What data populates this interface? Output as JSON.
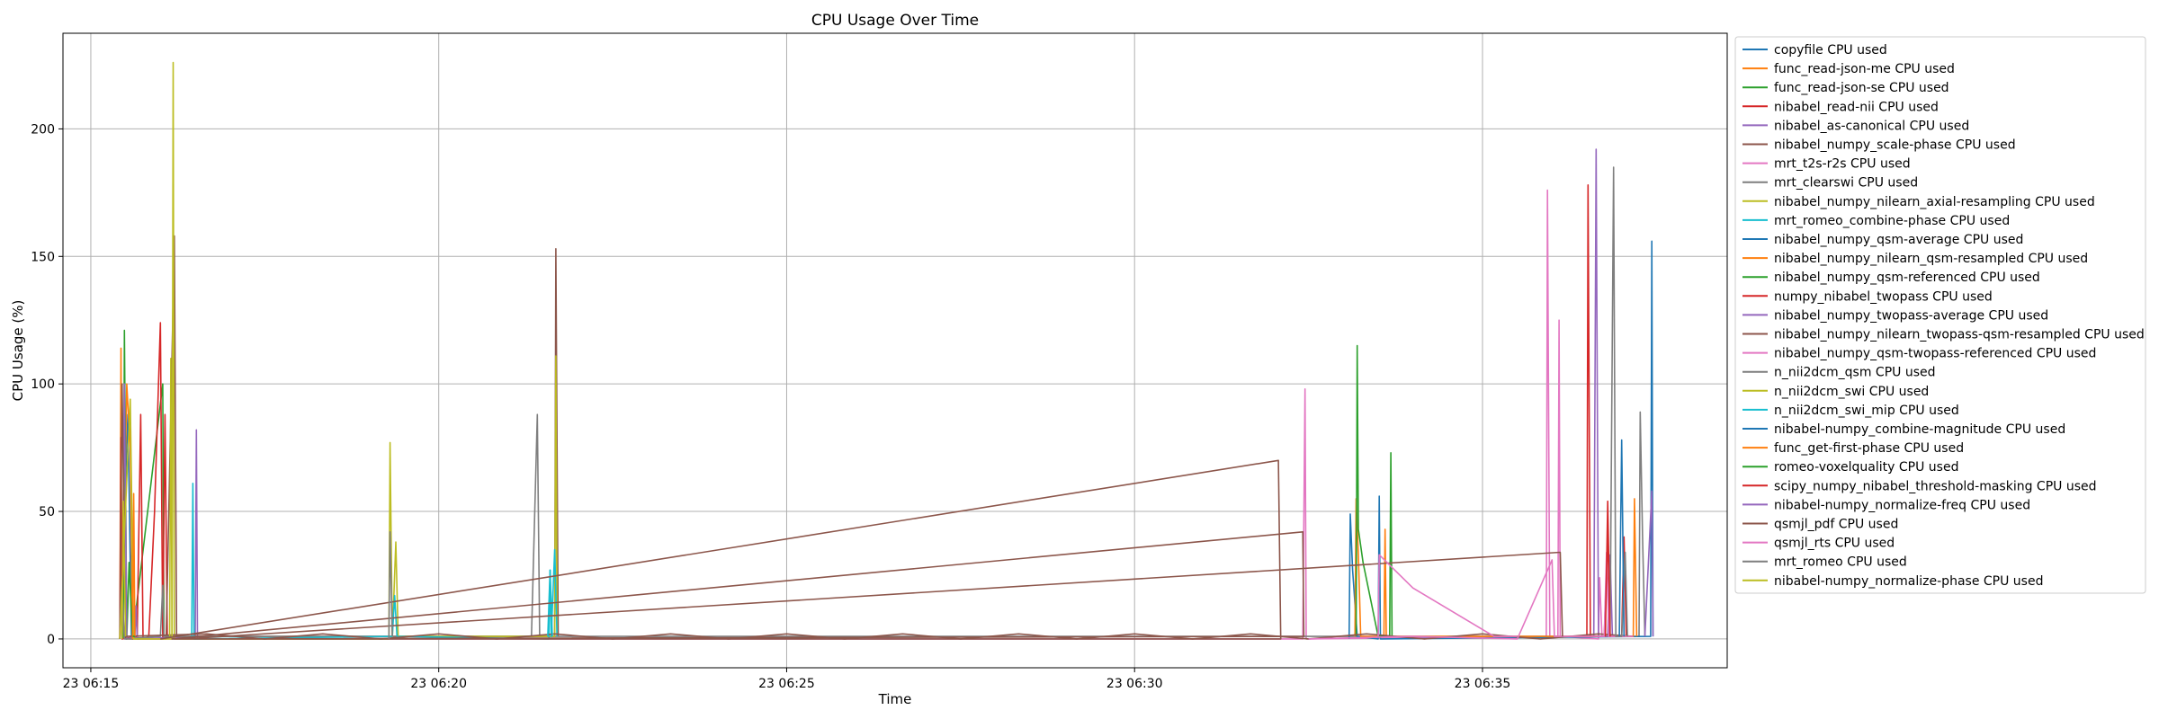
{
  "chart_data": {
    "type": "line",
    "title": "CPU Usage Over Time",
    "xlabel": "Time",
    "ylabel": "CPU Usage (%)",
    "x_unit": "time of day (HH:MM:SS), day 23",
    "x_ticks": [
      "06:15",
      "06:20",
      "06:25",
      "06:30",
      "06:35"
    ],
    "x_tick_labels": [
      "23 06:15",
      "23 06:20",
      "23 06:25",
      "23 06:30",
      "23 06:35"
    ],
    "xlim": [
      "06:14:36",
      "06:38:31"
    ],
    "y_ticks": [
      0,
      50,
      100,
      150,
      200
    ],
    "ylim": [
      -11.3,
      237.5
    ],
    "grid": true,
    "legend_position": "outside right",
    "series": [
      {
        "name": "copyfile CPU used",
        "color": "#1f77b4",
        "points": [
          [
            "06:15:25",
            0
          ],
          [
            "06:15:32",
            88
          ],
          [
            "06:15:35",
            1
          ],
          [
            "06:15:40",
            1
          ]
        ]
      },
      {
        "name": "func_read-json-me CPU used",
        "color": "#ff7f0e",
        "points": [
          [
            "06:15:25",
            0
          ],
          [
            "06:15:26",
            114
          ],
          [
            "06:15:27",
            0
          ],
          [
            "06:15:29",
            45
          ],
          [
            "06:15:31",
            100
          ],
          [
            "06:15:34",
            75
          ],
          [
            "06:15:36",
            1
          ]
        ]
      },
      {
        "name": "func_read-json-se CPU used",
        "color": "#2ca02c",
        "points": [
          [
            "06:15:28",
            0
          ],
          [
            "06:15:29",
            121
          ],
          [
            "06:15:31",
            0
          ],
          [
            "06:15:33",
            30
          ],
          [
            "06:15:36",
            0
          ],
          [
            "06:16:02",
            100
          ],
          [
            "06:16:03",
            1
          ]
        ]
      },
      {
        "name": "nibabel_read-nii CPU used",
        "color": "#d62728",
        "points": [
          [
            "06:15:25",
            0
          ],
          [
            "06:15:26",
            79
          ],
          [
            "06:15:27",
            0
          ],
          [
            "06:15:40",
            1
          ],
          [
            "06:15:43",
            88
          ],
          [
            "06:15:45",
            0
          ],
          [
            "06:15:50",
            1
          ],
          [
            "06:15:55",
            50
          ],
          [
            "06:16:00",
            124
          ],
          [
            "06:16:02",
            0
          ],
          [
            "06:16:04",
            88
          ],
          [
            "06:16:06",
            0
          ]
        ]
      },
      {
        "name": "nibabel_as-canonical CPU used",
        "color": "#9467bd",
        "points": [
          [
            "06:15:27",
            0
          ],
          [
            "06:15:29",
            100
          ],
          [
            "06:15:31",
            0
          ],
          [
            "06:15:38",
            1
          ],
          [
            "06:15:39",
            13
          ],
          [
            "06:15:40",
            0
          ],
          [
            "06:16:30",
            1
          ],
          [
            "06:16:31",
            82
          ],
          [
            "06:16:32",
            0
          ]
        ]
      },
      {
        "name": "nibabel_numpy_scale-phase CPU used",
        "color": "#8c564b",
        "points": [
          [
            "06:15:25",
            0
          ],
          [
            "06:15:27",
            100
          ],
          [
            "06:15:30",
            0
          ],
          [
            "06:16:05",
            0
          ],
          [
            "06:16:10",
            110
          ],
          [
            "06:16:12",
            158
          ],
          [
            "06:16:14",
            1
          ],
          [
            "06:21:40",
            1
          ],
          [
            "06:21:41",
            153
          ],
          [
            "06:21:43",
            1
          ]
        ]
      },
      {
        "name": "mrt_t2s-r2s CPU used",
        "color": "#e377c2",
        "points": [
          [
            "06:15:40",
            1
          ],
          [
            "06:15:42",
            0
          ],
          [
            "06:32:25",
            0
          ],
          [
            "06:32:27",
            98
          ],
          [
            "06:32:28",
            0
          ],
          [
            "06:35:55",
            1
          ],
          [
            "06:35:56",
            176
          ],
          [
            "06:35:58",
            1
          ],
          [
            "06:36:05",
            1
          ],
          [
            "06:36:06",
            125
          ],
          [
            "06:36:07",
            1
          ],
          [
            "06:36:40",
            0
          ],
          [
            "06:36:41",
            24
          ],
          [
            "06:36:43",
            1
          ]
        ]
      },
      {
        "name": "mrt_clearswi CPU used",
        "color": "#7f7f7f",
        "points": [
          [
            "06:15:25",
            0
          ],
          [
            "06:15:27",
            20
          ],
          [
            "06:15:29",
            0
          ],
          [
            "06:16:00",
            1
          ],
          [
            "06:16:02",
            21
          ],
          [
            "06:16:03",
            1
          ],
          [
            "06:21:20",
            1
          ],
          [
            "06:21:25",
            88
          ],
          [
            "06:21:27",
            1
          ],
          [
            "06:37:15",
            1
          ],
          [
            "06:37:16",
            89
          ],
          [
            "06:37:18",
            40
          ],
          [
            "06:37:20",
            1
          ]
        ]
      },
      {
        "name": "nibabel_numpy_nilearn_axial-resampling CPU used",
        "color": "#bcbd22",
        "points": [
          [
            "06:15:25",
            0
          ],
          [
            "06:15:34",
            94
          ],
          [
            "06:15:37",
            0
          ],
          [
            "06:16:10",
            0
          ],
          [
            "06:16:11",
            226
          ],
          [
            "06:16:12",
            0
          ],
          [
            "06:19:17",
            0
          ],
          [
            "06:19:18",
            77
          ],
          [
            "06:19:20",
            0
          ],
          [
            "06:19:23",
            38
          ],
          [
            "06:19:25",
            1
          ],
          [
            "06:21:40",
            1
          ],
          [
            "06:21:41",
            111
          ],
          [
            "06:21:42",
            1
          ]
        ]
      },
      {
        "name": "mrt_romeo_combine-phase CPU used",
        "color": "#17becf",
        "points": [
          [
            "06:16:27",
            0
          ],
          [
            "06:16:28",
            61
          ],
          [
            "06:16:29",
            0
          ],
          [
            "06:19:20",
            1
          ],
          [
            "06:19:22",
            17
          ],
          [
            "06:19:24",
            1
          ],
          [
            "06:21:35",
            0
          ],
          [
            "06:21:36",
            27
          ],
          [
            "06:21:37",
            1
          ],
          [
            "06:21:40",
            35
          ],
          [
            "06:21:42",
            1
          ]
        ]
      },
      {
        "name": "nibabel_numpy_qsm-average CPU used",
        "color": "#1f77b4",
        "points": [
          [
            "06:33:05",
            0
          ],
          [
            "06:33:06",
            49
          ],
          [
            "06:33:08",
            27
          ],
          [
            "06:33:12",
            1
          ],
          [
            "06:33:30",
            0
          ],
          [
            "06:33:31",
            56
          ],
          [
            "06:33:32",
            0
          ],
          [
            "06:37:25",
            1
          ],
          [
            "06:37:26",
            156
          ],
          [
            "06:37:27",
            1
          ]
        ]
      },
      {
        "name": "nibabel_numpy_nilearn_qsm-resampled CPU used",
        "color": "#ff7f0e",
        "points": [
          [
            "06:33:10",
            1
          ],
          [
            "06:33:11",
            55
          ],
          [
            "06:33:13",
            33
          ],
          [
            "06:33:15",
            1
          ],
          [
            "06:33:35",
            1
          ],
          [
            "06:33:36",
            43
          ],
          [
            "06:33:37",
            1
          ],
          [
            "06:37:10",
            1
          ],
          [
            "06:37:11",
            55
          ],
          [
            "06:37:13",
            1
          ]
        ]
      },
      {
        "name": "nibabel_numpy_qsm-referenced CPU used",
        "color": "#2ca02c",
        "points": [
          [
            "06:33:11",
            1
          ],
          [
            "06:33:12",
            115
          ],
          [
            "06:33:13",
            43
          ],
          [
            "06:33:17",
            30
          ],
          [
            "06:33:30",
            1
          ],
          [
            "06:33:40",
            1
          ],
          [
            "06:33:41",
            73
          ],
          [
            "06:33:42",
            1
          ]
        ]
      },
      {
        "name": "numpy_nibabel_twopass CPU used",
        "color": "#d62728",
        "points": [
          [
            "06:36:30",
            1
          ],
          [
            "06:36:31",
            178
          ],
          [
            "06:36:33",
            1
          ],
          [
            "06:36:45",
            1
          ],
          [
            "06:36:48",
            40
          ],
          [
            "06:36:50",
            1
          ],
          [
            "06:37:00",
            1
          ],
          [
            "06:37:02",
            40
          ],
          [
            "06:37:04",
            1
          ]
        ]
      },
      {
        "name": "nibabel_numpy_twopass-average CPU used",
        "color": "#9467bd",
        "points": [
          [
            "06:36:36",
            1
          ],
          [
            "06:36:38",
            192
          ],
          [
            "06:36:40",
            1
          ],
          [
            "06:36:48",
            1
          ],
          [
            "06:36:50",
            33
          ],
          [
            "06:36:52",
            1
          ]
        ]
      },
      {
        "name": "nibabel_numpy_nilearn_twopass-qsm-resampled CPU used",
        "color": "#8c564b",
        "points": [
          [
            "06:15:30",
            1
          ],
          [
            "06:16:40",
            2
          ],
          [
            "06:17:30",
            0
          ],
          [
            "06:18:20",
            2
          ],
          [
            "06:19:10",
            0
          ],
          [
            "06:20:00",
            2
          ],
          [
            "06:20:50",
            0
          ],
          [
            "06:21:40",
            2
          ],
          [
            "06:22:30",
            0
          ],
          [
            "06:23:20",
            2
          ],
          [
            "06:24:10",
            0
          ],
          [
            "06:25:00",
            2
          ],
          [
            "06:25:50",
            0
          ],
          [
            "06:26:40",
            2
          ],
          [
            "06:27:30",
            0
          ],
          [
            "06:28:20",
            2
          ],
          [
            "06:29:10",
            0
          ],
          [
            "06:30:00",
            2
          ],
          [
            "06:30:50",
            0
          ],
          [
            "06:31:40",
            2
          ],
          [
            "06:32:30",
            0
          ],
          [
            "06:33:20",
            2
          ],
          [
            "06:34:10",
            0
          ],
          [
            "06:35:00",
            2
          ],
          [
            "06:35:50",
            0
          ],
          [
            "06:36:40",
            2
          ],
          [
            "06:37:10",
            1
          ]
        ]
      },
      {
        "name": "nibabel_numpy_qsm-twopass-referenced CPU used",
        "color": "#e377c2",
        "points": [
          [
            "06:32:30",
            0
          ],
          [
            "06:34:00",
            1
          ],
          [
            "06:35:30",
            0
          ],
          [
            "06:36:00",
            31
          ],
          [
            "06:36:02",
            1
          ],
          [
            "06:36:45",
            1
          ],
          [
            "06:36:47",
            34
          ],
          [
            "06:36:49",
            1
          ],
          [
            "06:37:10",
            1
          ]
        ]
      },
      {
        "name": "n_nii2dcm_qsm CPU used",
        "color": "#7f7f7f",
        "points": [
          [
            "06:36:50",
            1
          ],
          [
            "06:36:53",
            185
          ],
          [
            "06:36:55",
            1
          ],
          [
            "06:37:00",
            1
          ],
          [
            "06:37:03",
            34
          ],
          [
            "06:37:05",
            1
          ]
        ]
      },
      {
        "name": "n_nii2dcm_swi CPU used",
        "color": "#bcbd22",
        "points": [
          [
            "06:15:27",
            0
          ],
          [
            "06:15:28",
            54
          ],
          [
            "06:15:30",
            1
          ]
        ]
      },
      {
        "name": "n_nii2dcm_swi_mip CPU used",
        "color": "#17becf",
        "points": [
          [
            "06:21:34",
            1
          ],
          [
            "06:21:36",
            27
          ],
          [
            "06:21:38",
            1
          ]
        ]
      },
      {
        "name": "nibabel-numpy_combine-magnitude CPU used",
        "color": "#1f77b4",
        "points": [
          [
            "06:36:58",
            1
          ],
          [
            "06:37:00",
            78
          ],
          [
            "06:37:02",
            1
          ]
        ]
      },
      {
        "name": "func_get-first-phase CPU used",
        "color": "#ff7f0e",
        "points": [
          [
            "06:15:36",
            0
          ],
          [
            "06:15:37",
            57
          ],
          [
            "06:15:38",
            1
          ]
        ]
      },
      {
        "name": "romeo-voxelquality CPU used",
        "color": "#2ca02c",
        "points": [
          [
            "06:15:36",
            1
          ],
          [
            "06:15:38",
            1
          ]
        ]
      },
      {
        "name": "scipy_numpy_nibabel_threshold-masking CPU used",
        "color": "#d62728",
        "points": [
          [
            "06:36:46",
            1
          ],
          [
            "06:36:48",
            54
          ],
          [
            "06:36:50",
            1
          ]
        ]
      },
      {
        "name": "nibabel-numpy_normalize-freq CPU used",
        "color": "#9467bd",
        "points": [
          [
            "06:37:20",
            1
          ],
          [
            "06:37:26",
            58
          ],
          [
            "06:37:27",
            1
          ]
        ]
      },
      {
        "name": "qsmjl_pdf CPU used",
        "color": "#8c564b",
        "points": [
          [
            "06:16:00",
            0
          ],
          [
            "06:32:04",
            70
          ],
          [
            "06:32:06",
            0
          ],
          [
            "06:16:10",
            0
          ],
          [
            "06:32:25",
            42
          ],
          [
            "06:32:26",
            1
          ],
          [
            "06:16:20",
            0
          ],
          [
            "06:36:07",
            34
          ],
          [
            "06:36:09",
            1
          ]
        ]
      },
      {
        "name": "qsmjl_rts CPU used",
        "color": "#e377c2",
        "points": [
          [
            "06:33:30",
            1
          ],
          [
            "06:33:31",
            33
          ],
          [
            "06:34:00",
            20
          ],
          [
            "06:35:10",
            1
          ],
          [
            "06:35:30",
            1
          ]
        ]
      },
      {
        "name": "mrt_romeo CPU used",
        "color": "#7f7f7f",
        "points": [
          [
            "06:19:17",
            0
          ],
          [
            "06:19:18",
            42
          ],
          [
            "06:19:20",
            1
          ]
        ]
      },
      {
        "name": "nibabel-numpy_normalize-phase CPU used",
        "color": "#bcbd22",
        "points": [
          [
            "06:16:08",
            1
          ],
          [
            "06:16:09",
            110
          ],
          [
            "06:16:10",
            1
          ]
        ]
      }
    ]
  }
}
